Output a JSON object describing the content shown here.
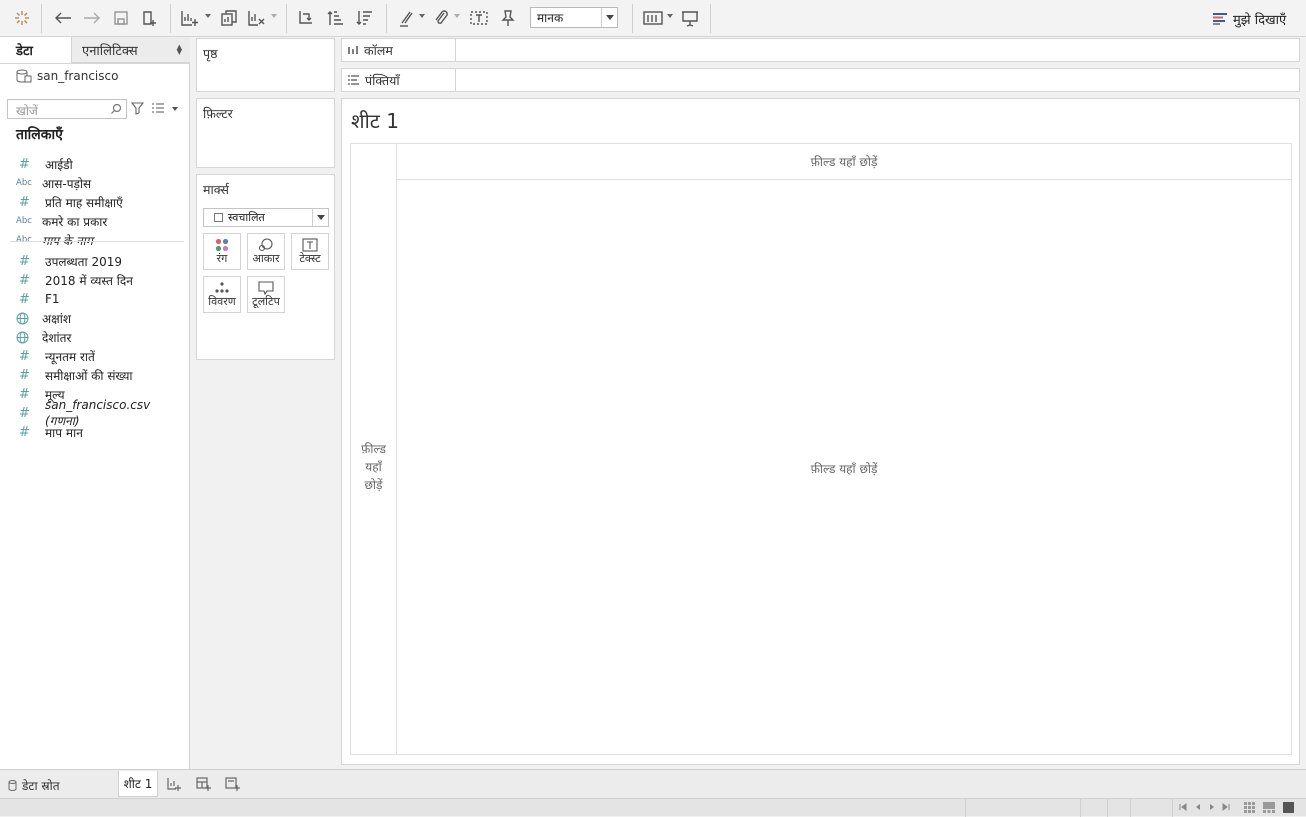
{
  "toolbar": {
    "fit_value": "मानक",
    "show_me_label": "मुझे दिखाएँ"
  },
  "data_pane": {
    "tab_data": "डेटा",
    "tab_analytics": "एनालिटिक्स",
    "datasource": "san_francisco",
    "search_placeholder": "खोजें",
    "tables_heading": "तालिकाएँ",
    "fields": [
      {
        "type": "number",
        "label": "आईडी"
      },
      {
        "type": "text",
        "label": "आस-पड़ोस"
      },
      {
        "type": "number",
        "label": "प्रति माह समीक्षाएँ"
      },
      {
        "type": "text",
        "label": "कमरे का प्रकार"
      },
      {
        "type": "text",
        "label": "माप के नाम",
        "italic": true
      },
      {
        "type": "number",
        "label": "उपलब्धता 2019"
      },
      {
        "type": "number",
        "label": "2018 में व्यस्त दिन"
      },
      {
        "type": "number",
        "label": "F1"
      },
      {
        "type": "geo",
        "label": "अक्षांश"
      },
      {
        "type": "geo",
        "label": "देशांतर"
      },
      {
        "type": "number",
        "label": "न्यूनतम रातें"
      },
      {
        "type": "number",
        "label": "समीक्षाओं की संख्या"
      },
      {
        "type": "number",
        "label": "मूल्य"
      },
      {
        "type": "number",
        "label": "san_francisco.csv (गणना)",
        "italic": true
      },
      {
        "type": "number",
        "label": "माप मान"
      }
    ]
  },
  "shelves": {
    "pages": "पृष्ठ",
    "filters": "फ़िल्टर",
    "marks": "मार्क्स",
    "mark_type": "स्वचालित",
    "mark_buttons": {
      "color": "रंग",
      "size": "आकार",
      "text": "टेक्स्ट",
      "detail": "विवरण",
      "tooltip": "टूलटिप"
    },
    "columns": "कॉलम",
    "rows": "पंक्तियाँ"
  },
  "sheet": {
    "title": "शीट 1",
    "drop_hint": "फ़ील्ड यहाँ छोड़ें",
    "drop_rows_line1": "फ़ील्ड",
    "drop_rows_line2": "यहाँ",
    "drop_rows_line3": "छोड़ें"
  },
  "bottom": {
    "datasource_tab": "डेटा स्रोत",
    "sheet_tab": "शीट 1"
  }
}
